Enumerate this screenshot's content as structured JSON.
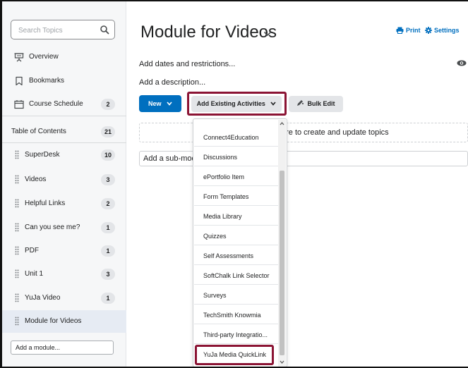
{
  "sidebar": {
    "search_placeholder": "Search Topics",
    "items": [
      {
        "label": "Overview"
      },
      {
        "label": "Bookmarks"
      },
      {
        "label": "Course Schedule",
        "count": "2"
      }
    ],
    "toc": {
      "label": "Table of Contents",
      "count": "21"
    },
    "modules": [
      {
        "label": "SuperDesk",
        "count": "10"
      },
      {
        "label": "Videos",
        "count": "3"
      },
      {
        "label": "Helpful Links",
        "count": "2"
      },
      {
        "label": "Can you see me?",
        "count": "1"
      },
      {
        "label": "PDF",
        "count": "1"
      },
      {
        "label": "Unit 1",
        "count": "3"
      },
      {
        "label": "YuJa Video",
        "count": "1"
      },
      {
        "label": "Module for Videos",
        "count": ""
      }
    ],
    "add_module": "Add a module..."
  },
  "main": {
    "title": "Module for Videos",
    "print": "Print",
    "settings": "Settings",
    "dates": "Add dates and restrictions...",
    "description": "Add a description...",
    "new_button": "New",
    "existing_button": "Add Existing Activities",
    "bulk_edit": "Bulk Edit",
    "dropzone_text": "ere to create and update topics",
    "submodule": "Add a sub-modu"
  },
  "menu": {
    "items": [
      "Connect4Education",
      "Discussions",
      "ePortfolio Item",
      "Form Templates",
      "Media Library",
      "Quizzes",
      "Self Assessments",
      "SoftChalk Link Selector",
      "Surveys",
      "TechSmith Knowmia",
      "Third-party Integratio...",
      "YuJa Media QuickLink"
    ]
  },
  "colors": {
    "accent": "#006fbf",
    "highlight": "#8b1434"
  }
}
